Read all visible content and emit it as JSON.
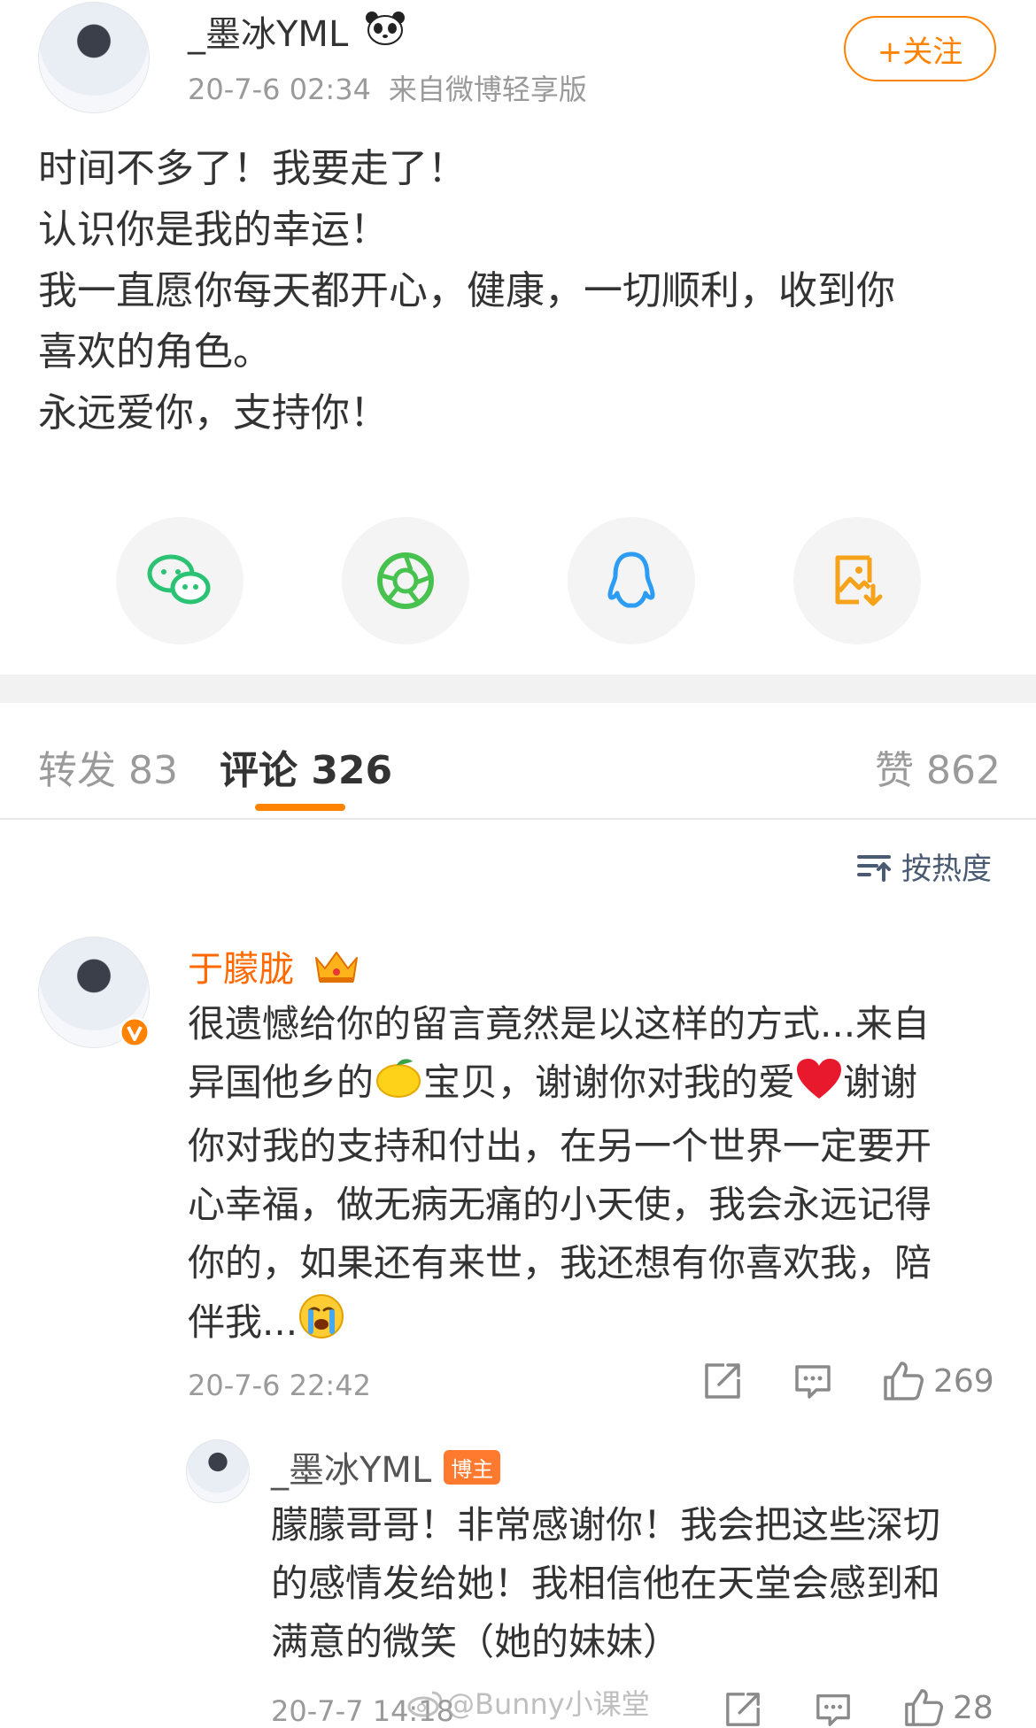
{
  "post": {
    "author": "_墨冰YML",
    "author_badge_icon": "panda-icon",
    "time": "20-7-6 02:34",
    "source": "来自微博轻享版",
    "follow_label": "+关注",
    "lines": [
      "时间不多了！我要走了！",
      "认识你是我的幸运！",
      "我一直愿你每天都开心，健康，一切顺利，收到你",
      "喜欢的角色。",
      "永远爱你，支持你！"
    ]
  },
  "share": {
    "items": [
      "wechat-icon",
      "moments-icon",
      "qq-icon",
      "save-image-icon"
    ],
    "colors": {
      "wechat": "#2bc373",
      "moments": "#47c24f",
      "qq": "#2d9cf4",
      "save": "#f7a21b"
    }
  },
  "tabs": {
    "repost": "转发 83",
    "comments": "评论 326",
    "likes": "赞 862"
  },
  "sort": {
    "label": "按热度"
  },
  "comments": [
    {
      "name": "于朦胧",
      "lines_a": [
        "很遗憾给你的留言竟然是以这样的方式...来自"
      ],
      "line2_pre": "异国他乡的",
      "line2_mid": "宝贝，谢谢你对我的爱",
      "line2_post": "谢谢",
      "lines_b": [
        "你对我的支持和付出，在另一个世界一定要开",
        "心幸福，做无病无痛的小天使，我会永远记得",
        "你的，如果还有来世，我还想有你喜欢我，陪"
      ],
      "line_last": "伴我...",
      "time": "20-7-6 22:42",
      "like_count": "269"
    },
    {
      "name": "_墨冰YML",
      "badge": "博主",
      "lines": [
        "朦朦哥哥！非常感谢你！我会把这些深切",
        "的感情发给她！我相信他在天堂会感到和",
        "满意的微笑（她的妹妹）"
      ],
      "time": "20-7-7 14:18",
      "like_count": "28"
    }
  ],
  "watermark": "@Bunny小课堂",
  "colors": {
    "accent": "#ff8200",
    "name_orange": "#ff6a00",
    "muted": "#9a9a9a",
    "sort": "#4a5a72"
  }
}
